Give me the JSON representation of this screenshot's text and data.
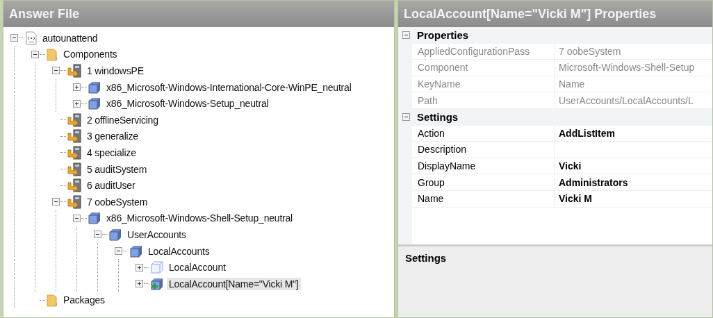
{
  "answer_file": {
    "title": "Answer File",
    "tree": [
      {
        "label": "autounattend",
        "kind": "file",
        "expanded": true,
        "selected": false,
        "children": [
          {
            "label": "Components",
            "kind": "folder",
            "expanded": true,
            "selected": false,
            "children": [
              {
                "label": "1 windowsPE",
                "kind": "pass",
                "expanded": true,
                "selected": false,
                "children": [
                  {
                    "label": "x86_Microsoft-Windows-International-Core-WinPE_neutral",
                    "kind": "component",
                    "expanded": false,
                    "selected": false
                  },
                  {
                    "label": "x86_Microsoft-Windows-Setup_neutral",
                    "kind": "component",
                    "expanded": false,
                    "selected": false
                  }
                ]
              },
              {
                "label": "2 offlineServicing",
                "kind": "pass",
                "selected": false
              },
              {
                "label": "3 generalize",
                "kind": "pass",
                "selected": false
              },
              {
                "label": "4 specialize",
                "kind": "pass",
                "selected": false
              },
              {
                "label": "5 auditSystem",
                "kind": "pass",
                "selected": false
              },
              {
                "label": "6 auditUser",
                "kind": "pass",
                "selected": false
              },
              {
                "label": "7 oobeSystem",
                "kind": "pass",
                "expanded": true,
                "selected": false,
                "children": [
                  {
                    "label": "x86_Microsoft-Windows-Shell-Setup_neutral",
                    "kind": "component",
                    "expanded": true,
                    "selected": false,
                    "children": [
                      {
                        "label": "UserAccounts",
                        "kind": "component",
                        "expanded": true,
                        "selected": false,
                        "children": [
                          {
                            "label": "LocalAccounts",
                            "kind": "component",
                            "expanded": true,
                            "selected": false,
                            "children": [
                              {
                                "label": "LocalAccount",
                                "kind": "template",
                                "expanded": false,
                                "selected": false
                              },
                              {
                                "label": "LocalAccount[Name=\"Vicki M\"]",
                                "kind": "added",
                                "expanded": false,
                                "selected": true
                              }
                            ]
                          }
                        ]
                      }
                    ]
                  }
                ]
              }
            ]
          },
          {
            "label": "Packages",
            "kind": "folder",
            "selected": false
          }
        ]
      }
    ]
  },
  "properties": {
    "title": "LocalAccount[Name=\"Vicki M\"] Properties",
    "categories": [
      {
        "name": "Properties",
        "expanded": true,
        "rows": [
          {
            "name": "AppliedConfigurationPass",
            "value": "7 oobeSystem",
            "readonly": true
          },
          {
            "name": "Component",
            "value": "Microsoft-Windows-Shell-Setup",
            "readonly": true
          },
          {
            "name": "KeyName",
            "value": "Name",
            "readonly": true
          },
          {
            "name": "Path",
            "value": "UserAccounts/LocalAccounts/L",
            "readonly": true
          }
        ]
      },
      {
        "name": "Settings",
        "expanded": true,
        "rows": [
          {
            "name": "Action",
            "value": "AddListItem",
            "readonly": false
          },
          {
            "name": "Description",
            "readonly": false
          },
          {
            "name": "DisplayName",
            "value": "Vicki",
            "readonly": false
          },
          {
            "name": "Group",
            "value": "Administrators",
            "readonly": false
          },
          {
            "name": "Name",
            "value": "Vicki M",
            "readonly": false
          }
        ]
      }
    ],
    "description": {
      "title": "Settings"
    }
  }
}
